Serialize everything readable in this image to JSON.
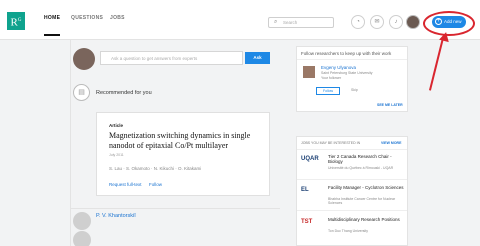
{
  "header": {
    "logo": "R",
    "logo_sup": "G",
    "nav": [
      {
        "label": "HOME",
        "active": true
      },
      {
        "label": "QUESTIONS",
        "active": false
      },
      {
        "label": "JOBS",
        "active": false
      }
    ],
    "search_placeholder": "Search",
    "add_new_label": "Add new",
    "icons": [
      "search-icon",
      "notification-icon",
      "message-icon",
      "bell-icon",
      "plus-icon"
    ]
  },
  "ask": {
    "placeholder": "Ask a question to get answers from experts",
    "button": "Ask"
  },
  "feed": {
    "recommended_label": "Recommended for you",
    "card": {
      "type": "Article",
      "title": "Magnetization switching dynamics in single nanodot of epitaxial Co/Pt multilayer",
      "date": "July 2011",
      "authors": "S. Lau · S. Okamoto · N. Kikuchi · O. Kitakami",
      "request_label": "Request full-text",
      "follow_label": "Follow"
    },
    "next_author": "P. V. Khantorskiî"
  },
  "follow_panel": {
    "header": "Follow researchers to keep up with their work",
    "researcher_name": "Evgeny Ulyanova",
    "researcher_inst": "Saint Petersburg State University",
    "researcher_role": "Your follower",
    "follow_btn": "Follow",
    "skip": "Skip",
    "see_later": "SEE ME LATER"
  },
  "jobs_panel": {
    "header": "JOBS YOU MAY BE INTERESTED IN",
    "view_more": "VIEW MORE",
    "jobs": [
      {
        "logo": "UQAR",
        "title": "Tier 2 Canada Research Chair - Biology",
        "org": "Université du Québec à Rimouski - UQAR"
      },
      {
        "logo": "EL",
        "title": "Facility Manager - Cyclotron Sciences",
        "org": "Bhabha Institute Cancer Centre for Nuclear Sciences"
      },
      {
        "logo": "TST",
        "title": "Multidisciplinary Research Positions",
        "org": "Ton Duc Thang University"
      }
    ]
  }
}
